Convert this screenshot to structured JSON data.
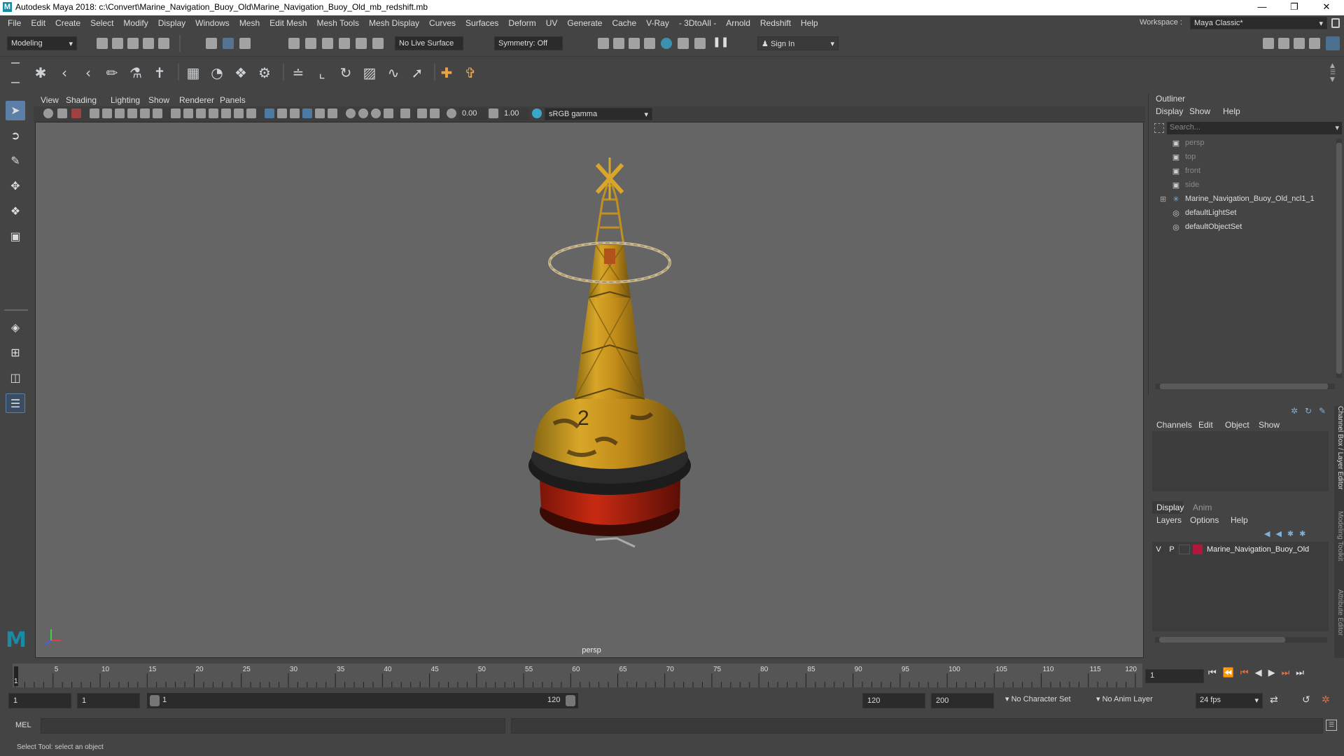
{
  "window": {
    "title": "Autodesk Maya 2018: c:\\Convert\\Marine_Navigation_Buoy_Old\\Marine_Navigation_Buoy_Old_mb_redshift.mb",
    "logo": "M"
  },
  "menu": [
    "File",
    "Edit",
    "Create",
    "Select",
    "Modify",
    "Display",
    "Windows",
    "Mesh",
    "Edit Mesh",
    "Mesh Tools",
    "Mesh Display",
    "Curves",
    "Surfaces",
    "Deform",
    "UV",
    "Generate",
    "Cache",
    "V-Ray",
    "- 3DtoAll -",
    "Arnold",
    "Redshift",
    "Help"
  ],
  "workspace": {
    "label": "Workspace :",
    "value": "Maya Classic*"
  },
  "toolbar": {
    "mode": "Modeling",
    "live_surface": "No Live Surface",
    "symmetry": "Symmetry: Off",
    "sign_in": "Sign In"
  },
  "viewport": {
    "menu": [
      "View",
      "Shading",
      "Lighting",
      "Show",
      "Renderer",
      "Panels"
    ],
    "exposure": "0.00",
    "gamma": "1.00",
    "color_space": "sRGB gamma",
    "camera_label": "persp",
    "buoy_number": "2"
  },
  "outliner": {
    "title": "Outliner",
    "menu": [
      "Display",
      "Show",
      "Help"
    ],
    "search_placeholder": "Search...",
    "items": [
      {
        "label": "persp",
        "icon": "camera-icon",
        "dim": true
      },
      {
        "label": "top",
        "icon": "camera-icon",
        "dim": true
      },
      {
        "label": "front",
        "icon": "camera-icon",
        "dim": true
      },
      {
        "label": "side",
        "icon": "camera-icon",
        "dim": true
      },
      {
        "label": "Marine_Navigation_Buoy_Old_ncl1_1",
        "icon": "group-icon",
        "dim": false
      },
      {
        "label": "defaultLightSet",
        "icon": "set-icon",
        "dim": false
      },
      {
        "label": "defaultObjectSet",
        "icon": "set-icon",
        "dim": false
      }
    ]
  },
  "channel_box": {
    "menu": [
      "Channels",
      "Edit",
      "Object",
      "Show"
    ],
    "side_tabs": [
      "Channel Box / Layer Editor",
      "Modeling Toolkit",
      "Attribute Editor"
    ]
  },
  "layers": {
    "tabs": [
      "Display",
      "Anim"
    ],
    "menu": [
      "Layers",
      "Options",
      "Help"
    ],
    "row": {
      "v": "V",
      "p": "P",
      "name": "Marine_Navigation_Buoy_Old",
      "color": "#b0173a"
    }
  },
  "timeline": {
    "ticks": [
      "5",
      "10",
      "15",
      "20",
      "25",
      "30",
      "35",
      "40",
      "45",
      "50",
      "55",
      "60",
      "65",
      "70",
      "75",
      "80",
      "85",
      "90",
      "95",
      "100",
      "105",
      "110",
      "115",
      "120"
    ],
    "current_frame_marker": "1",
    "current_frame": "1"
  },
  "range": {
    "start": "1",
    "anim_start": "1",
    "slider_start": "1",
    "slider_end": "120",
    "end": "120",
    "anim_end": "200",
    "character_set": "No Character Set",
    "anim_layer": "No Anim Layer",
    "fps": "24 fps"
  },
  "command": {
    "lang": "MEL"
  },
  "status": {
    "help": "Select Tool: select an object"
  }
}
